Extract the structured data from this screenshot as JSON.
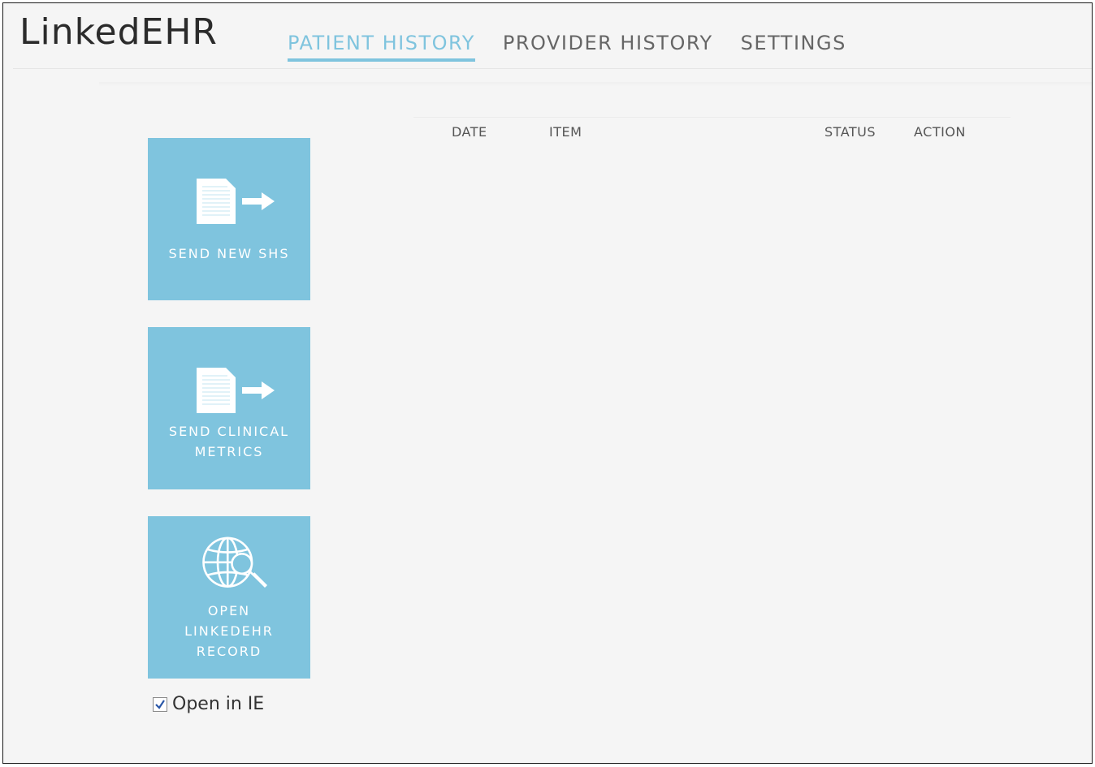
{
  "app": {
    "title": "LinkedEHR"
  },
  "nav": {
    "tabs": [
      {
        "label": "PATIENT HISTORY",
        "active": true
      },
      {
        "label": "PROVIDER HISTORY",
        "active": false
      },
      {
        "label": "SETTINGS",
        "active": false
      }
    ]
  },
  "history_table": {
    "columns": [
      "DATE",
      "ITEM",
      "STATUS",
      "ACTION"
    ],
    "rows": []
  },
  "actions": {
    "send_shs": {
      "label": "SEND NEW SHS",
      "icon": "document-send-icon"
    },
    "send_metrics": {
      "label_line1": "SEND CLINICAL",
      "label_line2": "METRICS",
      "icon": "document-send-icon"
    },
    "open_record": {
      "label_line1": "OPEN",
      "label_line2": "LINKEDEHR",
      "label_line3": "RECORD",
      "icon": "globe-search-icon"
    }
  },
  "open_in_ie": {
    "label": "Open in IE",
    "checked": true
  },
  "colors": {
    "accent": "#7fc4de",
    "background": "#f5f5f5",
    "text": "#2b2b2b",
    "nav_inactive": "#666666"
  }
}
